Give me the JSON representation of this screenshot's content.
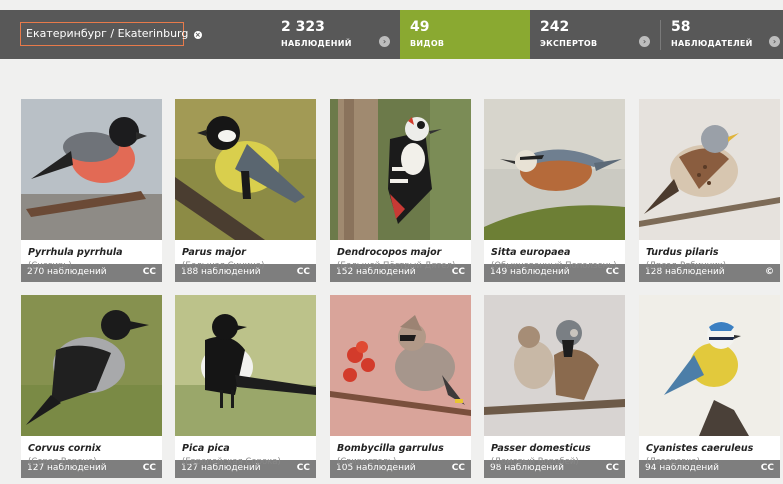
{
  "header": {
    "location": "Екатеринбург / Ekaterinburg",
    "stats": [
      {
        "value": "2 323",
        "label": "НАБЛЮДЕНИЙ"
      },
      {
        "value": "49",
        "label": "ВИДОВ"
      },
      {
        "value": "242",
        "label": "ЭКСПЕРТОВ"
      },
      {
        "value": "58",
        "label": "НАБЛЮДАТЕЛЕЙ"
      }
    ]
  },
  "species": [
    {
      "count": "270 наблюдений",
      "license": "CC",
      "latin": "Pyrrhula pyrrhula",
      "russian": "(Снегирь)"
    },
    {
      "count": "188 наблюдений",
      "license": "CC",
      "latin": "Parus major",
      "russian": "(Большая Синица)"
    },
    {
      "count": "152 наблюдений",
      "license": "CC",
      "latin": "Dendrocopos major",
      "russian": "(Большой Пёстрый Дятел)"
    },
    {
      "count": "149 наблюдений",
      "license": "CC",
      "latin": "Sitta europaea",
      "russian": "(Обыкновенный Поползень)"
    },
    {
      "count": "128 наблюдений",
      "license": "©",
      "latin": "Turdus pilaris",
      "russian": "(Дрозд-Рябинник)"
    },
    {
      "count": "127 наблюдений",
      "license": "CC",
      "latin": "Corvus cornix",
      "russian": "(Серая Ворона)"
    },
    {
      "count": "127 наблюдений",
      "license": "CC",
      "latin": "Pica pica",
      "russian": "(Европейская Сорока)"
    },
    {
      "count": "105 наблюдений",
      "license": "CC",
      "latin": "Bombycilla garrulus",
      "russian": "(Свиристель)"
    },
    {
      "count": "98 наблюдений",
      "license": "CC",
      "latin": "Passer domesticus",
      "russian": "(Домовый Воробей)"
    },
    {
      "count": "94 наблюдений",
      "license": "CC",
      "latin": "Cyanistes caeruleus",
      "russian": "(Лазоревка)"
    }
  ]
}
